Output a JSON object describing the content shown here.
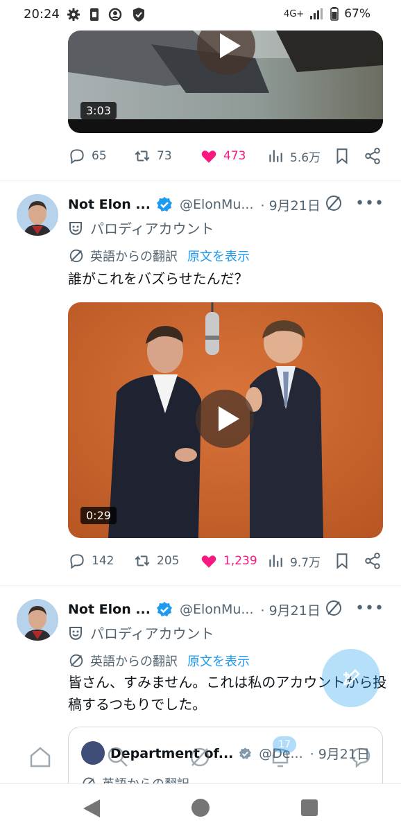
{
  "status_bar": {
    "time": "20:24",
    "network": "4G+",
    "battery": "67%"
  },
  "tweet_top": {
    "duration": "3:03",
    "stats": {
      "replies": "65",
      "retweets": "73",
      "likes": "473",
      "views": "5.6万"
    }
  },
  "tweet1": {
    "name": "Not Elon ...",
    "handle": "@ElonMu...",
    "date": "· 9月21日",
    "parody_label": "パロディアカウント",
    "translated_label": "英語からの翻訳",
    "show_original": "原文を表示",
    "text": "誰がこれをバズらせたんだ？",
    "duration": "0:29",
    "stats": {
      "replies": "142",
      "retweets": "205",
      "likes": "1,239",
      "views": "9.7万"
    }
  },
  "tweet2": {
    "name": "Not Elon ...",
    "handle": "@ElonMu...",
    "date": "· 9月21日",
    "parody_label": "パロディアカウント",
    "translated_label": "英語からの翻訳",
    "show_original": "原文を表示",
    "text": "皆さん、すみません。これは私のアカウントから投稿するつもりでした。",
    "quote": {
      "name": "Department of...",
      "handle": "@De...",
      "date": "· 9月21日",
      "translated_label": "英語からの翻訳"
    }
  },
  "tabbar": {
    "notifications_badge": "17"
  },
  "colors": {
    "accent": "#1d9bf0",
    "like": "#f91880",
    "muted": "#536471"
  }
}
